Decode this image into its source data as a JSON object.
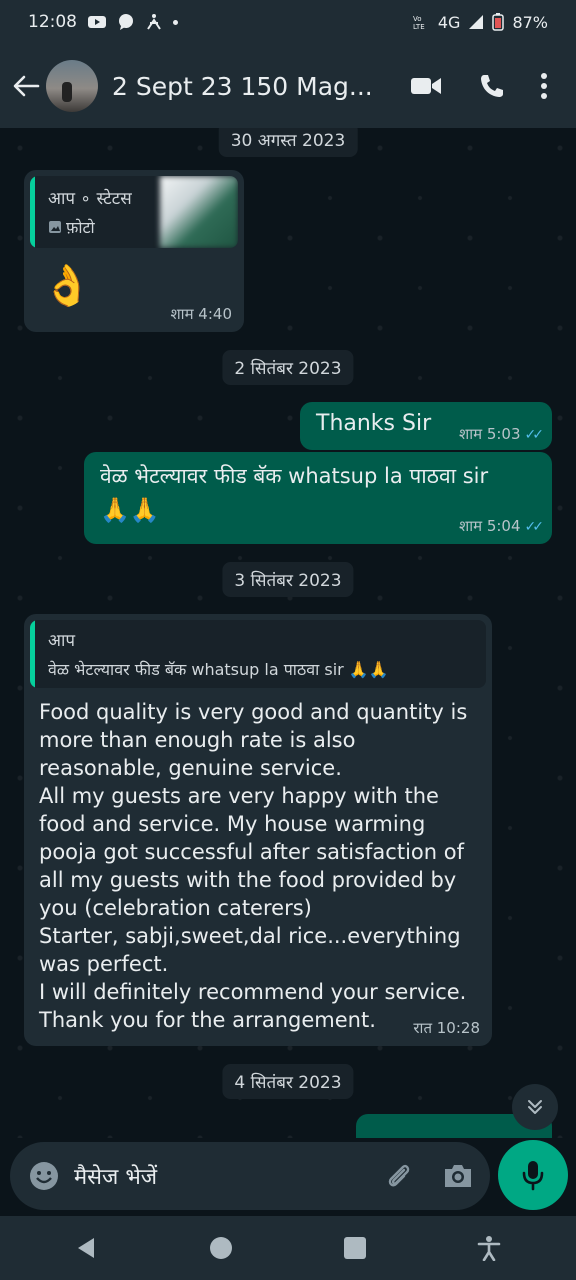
{
  "status": {
    "time": "12:08",
    "network": "4G",
    "battery": "87%"
  },
  "header": {
    "title": "2 Sept 23 150 Mag..."
  },
  "dates": {
    "d1": "30 अगस्त 2023",
    "d2": "2 सितंबर 2023",
    "d3": "3 सितंबर 2023",
    "d4": "4 सितंबर 2023"
  },
  "msg1": {
    "quote_author": "आप ∘ स्टेटस",
    "quote_type": "फ़ोटो",
    "emoji": "👌",
    "time": "शाम 4:40"
  },
  "msg2": {
    "text": "Thanks Sir",
    "time": "शाम 5:03"
  },
  "msg3": {
    "text": "वेळ भेटल्यावर फीड बॅक whatsup la पाठवा sir",
    "emoji": "🙏🙏",
    "time": "शाम 5:04"
  },
  "msg4": {
    "quote_author": "आप",
    "quote_text": "वेळ भेटल्यावर फीड बॅक whatsup la पाठवा sir 🙏🙏",
    "lines": [
      "Food quality is very good and quantity is",
      "more than enough rate is also",
      "reasonable, genuine service.",
      "All my guests are very happy with the",
      "food and service. My house warming",
      "pooja got successful after satisfaction of",
      "all my guests with the food provided by",
      "you (celebration caterers)",
      "Starter, sabji,sweet,dal rice...everything",
      "was perfect.",
      "I will definitely recommend your service.",
      "Thank you for the arrangement."
    ],
    "time": "रात 10:28"
  },
  "composer": {
    "placeholder": "मैसेज भेजें"
  },
  "colors": {
    "accent": "#00a884",
    "outgoing": "#005c4b",
    "incoming": "#1f2c34",
    "read_ticks": "#53bdeb"
  }
}
